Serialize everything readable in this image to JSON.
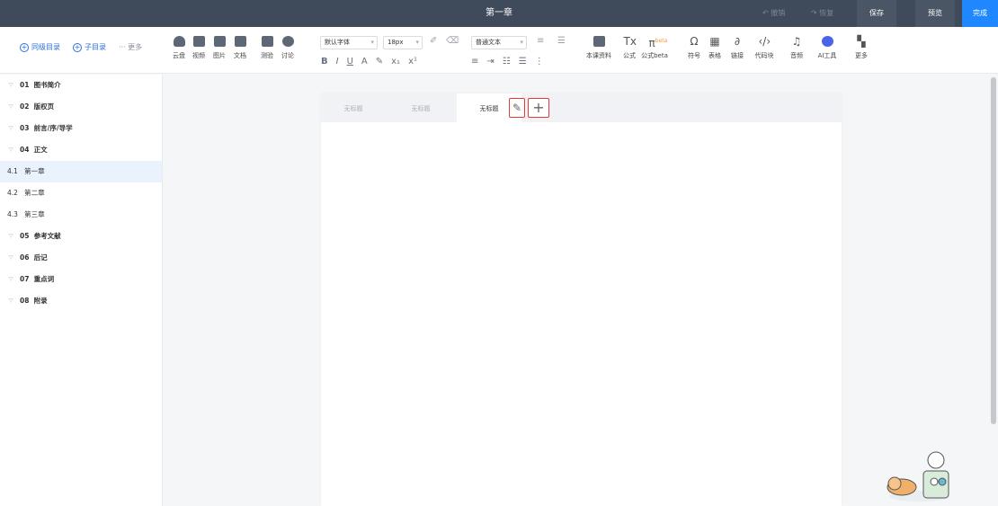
{
  "header": {
    "title": "第一章",
    "undo_label": "撤销",
    "redo_label": "恢复",
    "save_label": "保存",
    "preview_label": "预览",
    "done_label": "完成"
  },
  "nav": {
    "sibling_label": "同级目录",
    "child_label": "子目录",
    "more_label": "更多"
  },
  "toolbar": {
    "cloud": "云盘",
    "video": "视频",
    "image": "图片",
    "doc": "文档",
    "quiz": "测验",
    "discuss": "讨论",
    "font_family": "默认字体",
    "font_size": "18px",
    "paragraph": "普通文本",
    "course_material": "本课资料",
    "formula": "公式",
    "formula_beta": "公式beta",
    "symbol": "符号",
    "table": "表格",
    "link": "链接",
    "code_block": "代码块",
    "audio": "音频",
    "ai_tools": "AI工具",
    "more": "更多",
    "beta_tag": "beta"
  },
  "sidebar": {
    "items": [
      {
        "num": "01",
        "label": "图书简介"
      },
      {
        "num": "02",
        "label": "版权页"
      },
      {
        "num": "03",
        "label": "前言/序/导学"
      },
      {
        "num": "04",
        "label": "正文"
      },
      {
        "num": "4.1",
        "label": "第一章"
      },
      {
        "num": "4.2",
        "label": "第二章"
      },
      {
        "num": "4.3",
        "label": "第三章"
      },
      {
        "num": "05",
        "label": "参考文献"
      },
      {
        "num": "06",
        "label": "后记"
      },
      {
        "num": "07",
        "label": "重点词"
      },
      {
        "num": "08",
        "label": "附录"
      }
    ]
  },
  "editor": {
    "tabs": [
      "无标题",
      "无标题",
      "无标题"
    ]
  },
  "colors": {
    "header_bg": "#3f4a5a",
    "accent": "#1f87ff",
    "highlight_border": "#e53935"
  }
}
